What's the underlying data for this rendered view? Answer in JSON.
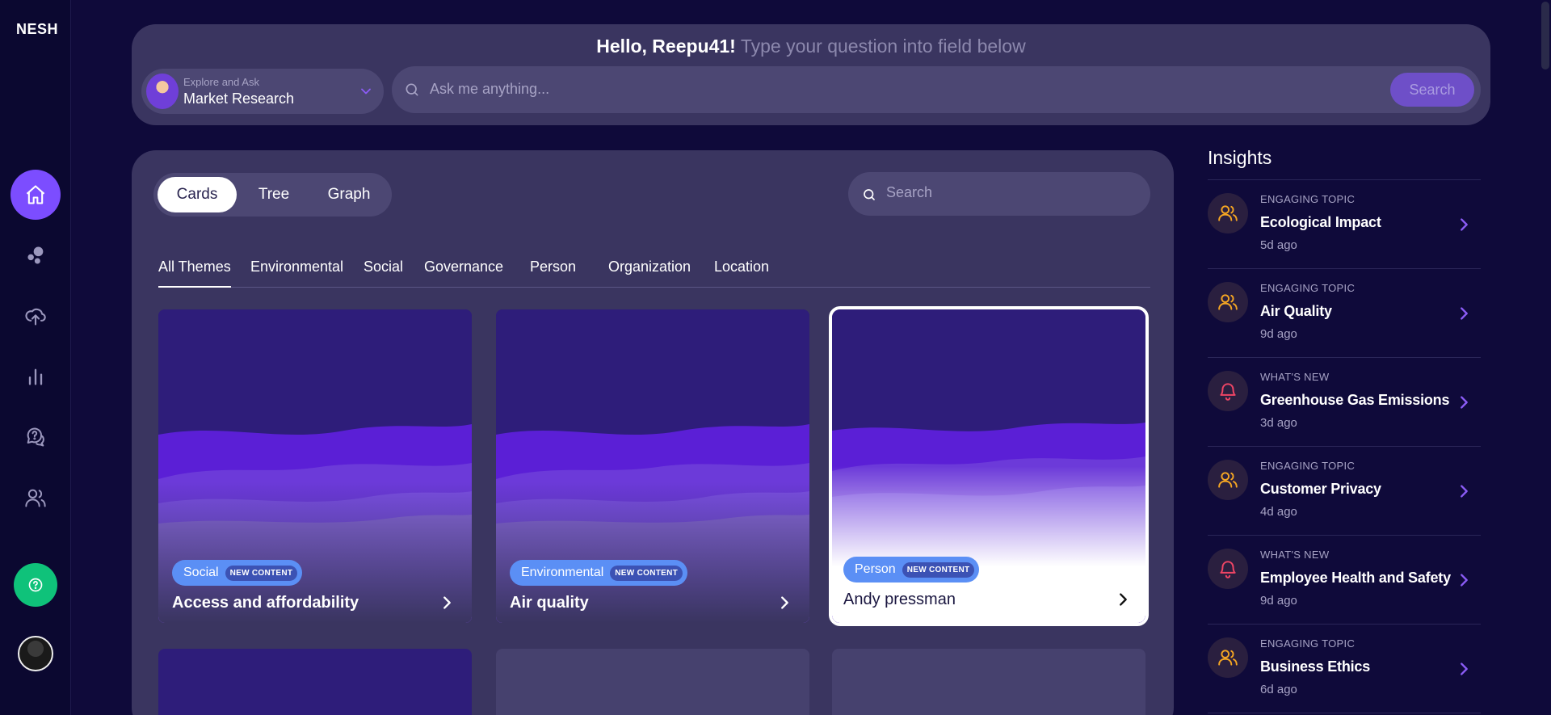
{
  "app": {
    "logo": "NESH"
  },
  "sidebar": {
    "items": [
      {
        "name": "home",
        "icon": "home-icon",
        "active": true
      },
      {
        "name": "topics",
        "icon": "bubbles-icon",
        "active": false
      },
      {
        "name": "upload",
        "icon": "cloud-upload-icon",
        "active": false
      },
      {
        "name": "analytics",
        "icon": "bar-chart-icon",
        "active": false
      },
      {
        "name": "questions",
        "icon": "question-chat-icon",
        "active": false
      },
      {
        "name": "users",
        "icon": "users-icon",
        "active": false
      }
    ],
    "help_icon": "help-circle-icon"
  },
  "ask": {
    "hello": "Hello, Reepu41!",
    "subtitle": "Type your question into field below",
    "mode_label": "Explore and Ask",
    "mode_value": "Market Research",
    "placeholder": "Ask me anything...",
    "button": "Search"
  },
  "views": {
    "items": [
      "Cards",
      "Tree",
      "Graph"
    ],
    "active": "Cards"
  },
  "card_search": {
    "placeholder": "Search"
  },
  "themes": {
    "items": [
      "All Themes",
      "Environmental",
      "Social",
      "Governance",
      "Person",
      "Organization",
      "Location"
    ],
    "active": "All Themes"
  },
  "cards": [
    {
      "category": "Social",
      "badge": "NEW CONTENT",
      "title": "Access and affordability",
      "selected": false
    },
    {
      "category": "Environmental",
      "badge": "NEW CONTENT",
      "title": "Air quality",
      "selected": false
    },
    {
      "category": "Person",
      "badge": "NEW CONTENT",
      "title": "Andy pressman",
      "selected": true
    }
  ],
  "insights": {
    "title": "Insights",
    "items": [
      {
        "kicker": "ENGAGING TOPIC",
        "title": "Ecological Impact",
        "time": "5d ago",
        "icon": "users-icon",
        "color": "#f5a623"
      },
      {
        "kicker": "ENGAGING TOPIC",
        "title": "Air Quality",
        "time": "9d ago",
        "icon": "users-icon",
        "color": "#f5a623"
      },
      {
        "kicker": "WHAT'S NEW",
        "title": "Greenhouse Gas Emissions",
        "time": "3d ago",
        "icon": "bell-icon",
        "color": "#ef4565"
      },
      {
        "kicker": "ENGAGING TOPIC",
        "title": "Customer Privacy",
        "time": "4d ago",
        "icon": "users-icon",
        "color": "#f5a623"
      },
      {
        "kicker": "WHAT'S NEW",
        "title": "Employee Health and Safety",
        "time": "9d ago",
        "icon": "bell-icon",
        "color": "#ef4565"
      },
      {
        "kicker": "ENGAGING TOPIC",
        "title": "Business Ethics",
        "time": "6d ago",
        "icon": "users-icon",
        "color": "#f5a623"
      }
    ]
  },
  "colors": {
    "accent": "#7c4dff",
    "panel": "#3a3560",
    "background": "#0f0a3a",
    "badge": "#5b8ff5",
    "help": "#0fc27a"
  }
}
